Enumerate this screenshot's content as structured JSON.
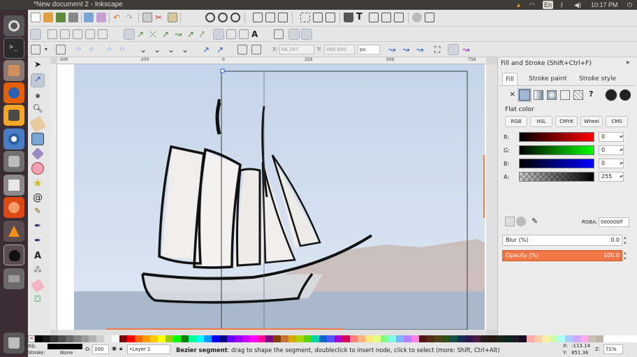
{
  "window": {
    "title": "*New document 2 - Inkscape"
  },
  "system_tray": {
    "keyboard": "En",
    "time": "10:17 PM"
  },
  "launcher": {
    "items": [
      "dash-icon",
      "terminal-icon",
      "files-icon",
      "firefox-icon",
      "sublime-icon",
      "chromium-icon",
      "camera-icon",
      "editor-icon",
      "ubuntu-software-icon",
      "vlc-icon",
      "inkscape-icon",
      "drive-icon",
      "trash-icon"
    ]
  },
  "toolbar_coords": {
    "x_label": "X:",
    "x_value": "66.267",
    "y_label": "Y:",
    "y_value": "466.690",
    "unit": "px"
  },
  "ruler": {
    "h_ticks": [
      "-500",
      "-250",
      "0",
      "250",
      "500",
      "750"
    ]
  },
  "panel": {
    "title": "Fill and Stroke (Shift+Ctrl+F)",
    "tabs": [
      "Fill",
      "Stroke paint",
      "Stroke style"
    ],
    "paint_types": [
      "none",
      "flat",
      "linear",
      "radial",
      "mesh",
      "pattern",
      "unset"
    ],
    "unset_label": "?",
    "flat_color_label": "Flat color",
    "mode_buttons": [
      "RGB",
      "HSL",
      "CMYK",
      "Wheel",
      "CMS"
    ],
    "channels": [
      {
        "label": "R:",
        "value": "0"
      },
      {
        "label": "G:",
        "value": "0"
      },
      {
        "label": "B:",
        "value": "0"
      },
      {
        "label": "A:",
        "value": "255"
      }
    ],
    "rgba_label": "RGBA:",
    "rgba_value": "000000ff",
    "blur_label": "Blur (%)",
    "blur_value": "0.0",
    "opacity_label": "Opacity (%)",
    "opacity_value": "100.0"
  },
  "palette": {
    "colors": [
      "#000000",
      "#1a1a1a",
      "#333333",
      "#4d4d4d",
      "#666666",
      "#808080",
      "#999999",
      "#b3b3b3",
      "#cccccc",
      "#e6e6e6",
      "#ffffff",
      "#800000",
      "#ff0000",
      "#ff6600",
      "#ff9900",
      "#ffcc00",
      "#ffff00",
      "#99cc00",
      "#00ff00",
      "#008000",
      "#00ff99",
      "#00ffff",
      "#0099ff",
      "#0000ff",
      "#000080",
      "#6600ff",
      "#9900ff",
      "#cc00ff",
      "#ff00ff",
      "#ff0099",
      "#800080",
      "#804000",
      "#c87137",
      "#d4aa00",
      "#aad400",
      "#55d400",
      "#00d4aa",
      "#0066cc",
      "#5555ff",
      "#aa00d4",
      "#d40055",
      "#ff8080",
      "#ffb380",
      "#ffe680",
      "#e5ff80",
      "#80ff80",
      "#80ffe6",
      "#80b3ff",
      "#b380ff",
      "#ff80e5",
      "#501616",
      "#502d16",
      "#504416",
      "#2d5016",
      "#165044",
      "#162d50",
      "#2d1650",
      "#501644",
      "#241c1c",
      "#28170b",
      "#1c241c",
      "#0b2817",
      "#1c1c24",
      "#170b28",
      "#ffaaaa",
      "#ffccaa",
      "#ffeeaa",
      "#ccffaa",
      "#aaffee",
      "#aaccff",
      "#ccaaff",
      "#ffaaee",
      "#c8beb7",
      "#bcb5a8"
    ]
  },
  "status": {
    "fill_label": "Fill:",
    "stroke_label": "Stroke:",
    "stroke_value": "None",
    "opacity_label": "O:",
    "opacity_value": "100",
    "layer": "•Layer 1",
    "message_bold": "Bezier segment",
    "message": ": drag to shape the segment, doubleclick to insert node, click to select (more: Shift, Ctrl+Alt)",
    "x_label": "X:",
    "x_value": "-113.14",
    "y_label": "Y:",
    "y_value": "851.36",
    "zoom_label": "Z:",
    "zoom_value": "71%"
  },
  "colors": {
    "accent": "#f07746",
    "selection": "#c4cad3"
  }
}
